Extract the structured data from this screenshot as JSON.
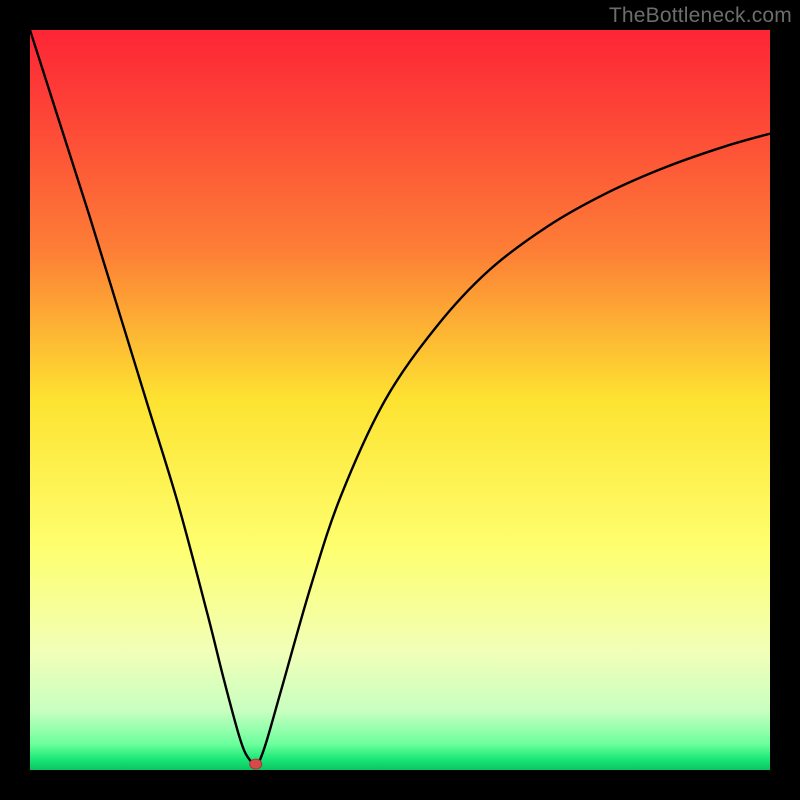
{
  "watermark": "TheBottleneck.com",
  "colors": {
    "frame": "#000000",
    "curve": "#000000",
    "marker_fill": "#d54b49",
    "marker_stroke": "#a83735",
    "gradient_stops": [
      {
        "offset": 0.0,
        "color": "#fd2536"
      },
      {
        "offset": 0.12,
        "color": "#fd4637"
      },
      {
        "offset": 0.3,
        "color": "#fd7f36"
      },
      {
        "offset": 0.5,
        "color": "#fde331"
      },
      {
        "offset": 0.7,
        "color": "#feff6f"
      },
      {
        "offset": 0.84,
        "color": "#f1ffb8"
      },
      {
        "offset": 0.92,
        "color": "#c8ffc0"
      },
      {
        "offset": 0.965,
        "color": "#6cff9d"
      },
      {
        "offset": 0.985,
        "color": "#1ce777"
      },
      {
        "offset": 1.0,
        "color": "#09c562"
      }
    ]
  },
  "chart_data": {
    "type": "line",
    "title": "",
    "xlabel": "",
    "ylabel": "",
    "xlim": [
      0,
      100
    ],
    "ylim": [
      0,
      100
    ],
    "series": [
      {
        "name": "bottleneck-curve",
        "x": [
          0,
          4,
          8,
          12,
          16,
          20,
          24,
          26,
          28,
          29,
          30,
          30.5,
          31,
          32,
          34,
          38,
          42,
          48,
          55,
          62,
          70,
          78,
          86,
          94,
          100
        ],
        "y": [
          100,
          87.5,
          75,
          62,
          49,
          36,
          21,
          13,
          5.5,
          2.5,
          1.0,
          0.8,
          1.2,
          4,
          11,
          25,
          37,
          50,
          60,
          67.5,
          73.5,
          78,
          81.5,
          84.3,
          86
        ]
      }
    ],
    "annotations": [
      {
        "name": "min-marker",
        "x": 30.5,
        "y": 0.8
      }
    ]
  }
}
